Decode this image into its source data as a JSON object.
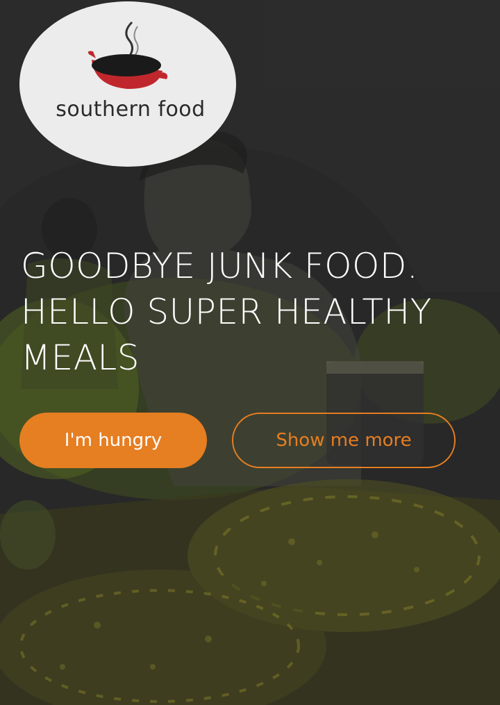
{
  "logo": {
    "text": "southern food",
    "icon": "cooking-pan-icon",
    "pan_color": "#c0272d"
  },
  "hero": {
    "headline_lines": [
      "GOODBYE JUNK FOOD.",
      "HELLO SUPER HEALTHY",
      "MEALS"
    ],
    "primary_button": "I'm hungry",
    "secondary_button": "Show me more"
  },
  "colors": {
    "accent": "#e67e22",
    "background": "#323232",
    "illustration_green": "#7f9a2a",
    "illustration_yellow": "#c9c233"
  }
}
